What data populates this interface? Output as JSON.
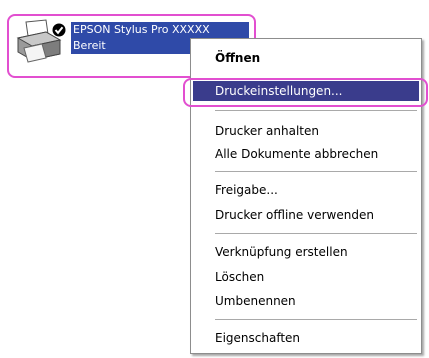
{
  "colors": {
    "highlight_outline": "#e24fd0",
    "selection_bg": "#3a3c8c",
    "label_bg": "#2f4aa8"
  },
  "printer": {
    "icon": "printer-icon",
    "default_badge_icon": "checkmark-icon",
    "name": "EPSON Stylus Pro XXXXX",
    "status": "Bereit"
  },
  "menu": {
    "open": "Öffnen",
    "print_settings": "Druckeinstellungen...",
    "pause_printer": "Drucker anhalten",
    "cancel_all": "Alle Dokumente abbrechen",
    "sharing": "Freigabe...",
    "use_offline": "Drucker offline verwenden",
    "create_shortcut": "Verknüpfung erstellen",
    "delete": "Löschen",
    "rename": "Umbenennen",
    "properties": "Eigenschaften"
  }
}
